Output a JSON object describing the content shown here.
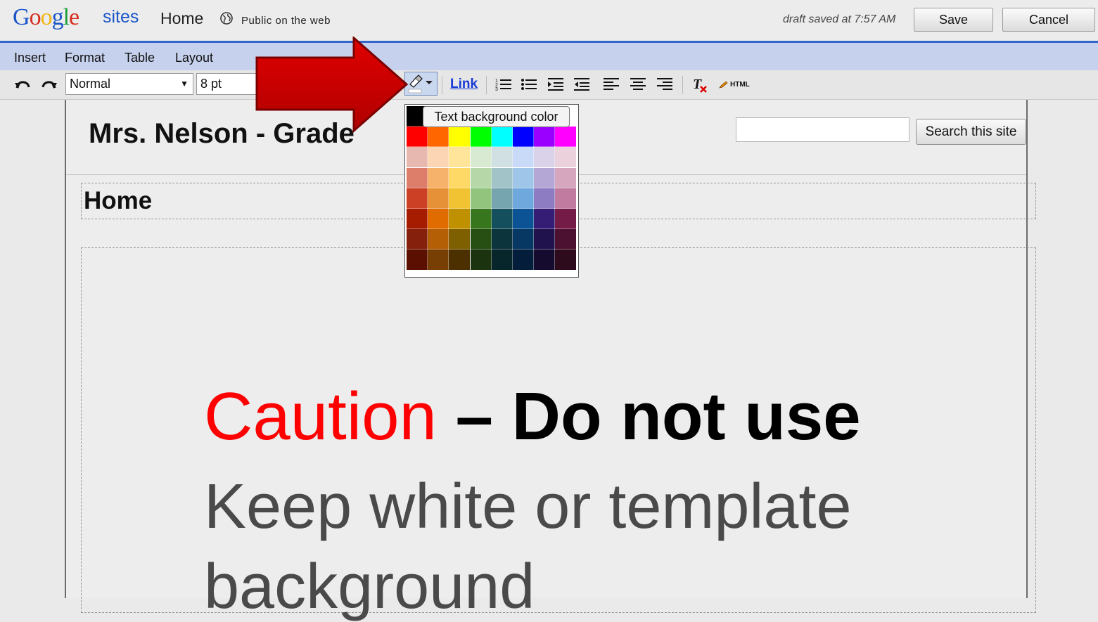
{
  "topbar": {
    "product": "sites",
    "page_name": "Home",
    "visibility": "Public on the web",
    "draft_status": "draft saved at 7:57 AM",
    "save_label": "Save",
    "cancel_label": "Cancel"
  },
  "menu": [
    "Insert",
    "Format",
    "Table",
    "Layout"
  ],
  "toolbar": {
    "style_select": "Normal",
    "size_select": "8 pt",
    "link_label": "Link",
    "html_label": "HTML",
    "tooltip": "Text background color"
  },
  "site": {
    "title": "Mrs. Nelson - Grade",
    "search_button": "Search this site",
    "search_value": "",
    "page_heading": "Home"
  },
  "content": {
    "caution_word": "Caution",
    "caution_rest": " – Do not use",
    "keep_line_1": "Keep white or template",
    "keep_line_2": "background"
  },
  "palette": {
    "rows": [
      [
        "#000000",
        "#434343",
        "#666666",
        "#999999",
        "#b7b7b7",
        "#cccccc",
        "#efefef",
        "#ffffff"
      ],
      [
        "#ff0000",
        "#ff6600",
        "#ffff00",
        "#00ff00",
        "#00ffff",
        "#0000ff",
        "#9900ff",
        "#ff00ff"
      ],
      [
        "#e6b8af",
        "#fcd5b4",
        "#ffe599",
        "#d9ead3",
        "#d0e0e3",
        "#c9daf8",
        "#d9d2e9",
        "#ead1dc"
      ],
      [
        "#dd7e6b",
        "#f6b26b",
        "#ffd966",
        "#b6d7a8",
        "#a2c4c9",
        "#9fc5e8",
        "#b4a7d6",
        "#d5a6bd"
      ],
      [
        "#cc4125",
        "#e69138",
        "#f1c232",
        "#93c47d",
        "#76a5af",
        "#6fa8dc",
        "#8e7cc3",
        "#c27ba0"
      ],
      [
        "#a61c00",
        "#e06c00",
        "#bf9000",
        "#38761d",
        "#134f5c",
        "#0b5394",
        "#351c75",
        "#741b47"
      ],
      [
        "#85200c",
        "#b45f06",
        "#7f6000",
        "#274e13",
        "#0c343d",
        "#073763",
        "#20124d",
        "#4c1130"
      ],
      [
        "#5b0f00",
        "#783f04",
        "#4c3000",
        "#1c3310",
        "#07262c",
        "#041d3b",
        "#140b2e",
        "#2e0b1c"
      ]
    ]
  },
  "colors": {
    "accent_blue": "#3366cc",
    "menubar_bg": "#c6d1ee",
    "arrow_red": "#cc0000",
    "caution_red": "#ff0000"
  },
  "icons": [
    "undo-icon",
    "redo-icon",
    "text-bg-color-icon",
    "numbered-list-icon",
    "bulleted-list-icon",
    "indent-icon",
    "outdent-icon",
    "align-left-icon",
    "align-center-icon",
    "align-right-icon",
    "remove-formatting-icon",
    "html-edit-icon",
    "globe-icon"
  ]
}
